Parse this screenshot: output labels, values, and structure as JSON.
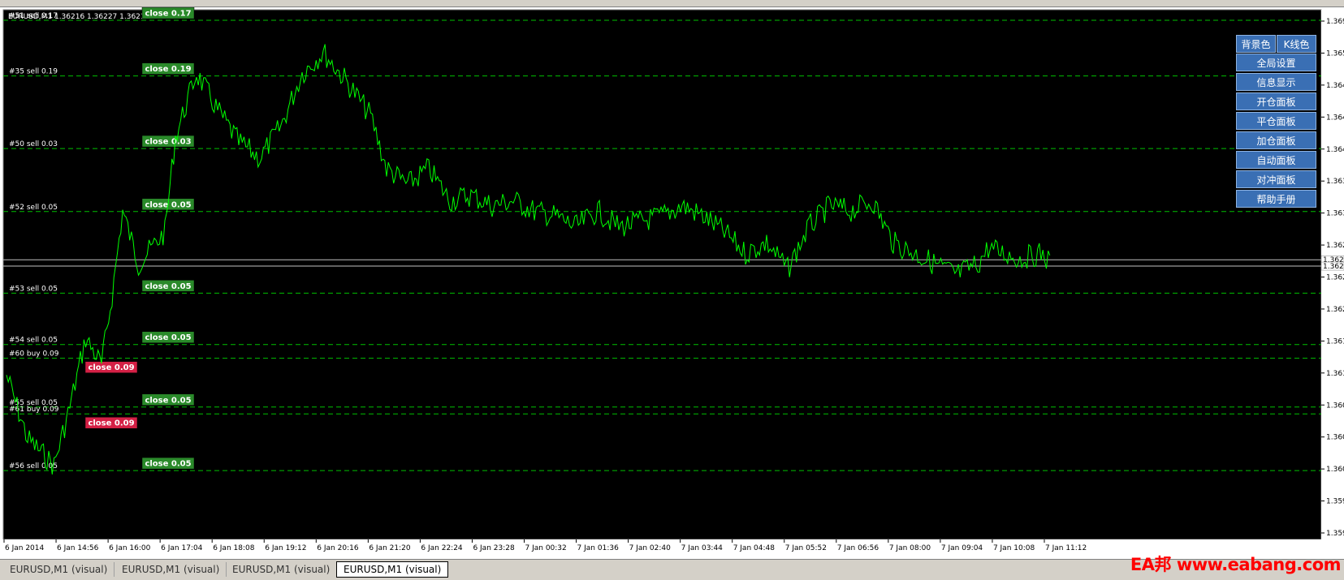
{
  "chart": {
    "symbol_info": "EURUSD,M1  1.36216 1.36227 1.36214 1.36225",
    "line_color": "#00ff00",
    "background": "#000000",
    "grid_line_color": "#00c000",
    "y_axis_labels": [
      "1.369",
      "1.365",
      "1.364",
      "1.364",
      "1.364",
      "1.363",
      "1.363",
      "1.362",
      "1.362",
      "1.362",
      "1.361",
      "1.361",
      "1.360",
      "1.360",
      "1.360",
      "1.359",
      "1.359"
    ],
    "price_tags": [
      "1.362",
      "1.362"
    ],
    "x_axis_labels": [
      "6 Jan 2014",
      "6 Jan 14:56",
      "6 Jan 16:00",
      "6 Jan 17:04",
      "6 Jan 18:08",
      "6 Jan 19:12",
      "6 Jan 20:16",
      "6 Jan 21:20",
      "6 Jan 22:24",
      "6 Jan 23:28",
      "7 Jan 00:32",
      "7 Jan 01:36",
      "7 Jan 02:40",
      "7 Jan 03:44",
      "7 Jan 04:48",
      "7 Jan 05:52",
      "7 Jan 06:56",
      "7 Jan 08:00",
      "7 Jan 09:04",
      "7 Jan 10:08",
      "7 Jan 11:12"
    ]
  },
  "orders": [
    {
      "label": "#51 sell 0.17",
      "close": "close 0.17",
      "type": "sell",
      "level": 0.02
    },
    {
      "label": "#35 sell 0.19",
      "close": "close 0.19",
      "type": "sell",
      "level": 0.125
    },
    {
      "label": "#50 sell 0.03",
      "close": "close 0.03",
      "type": "sell",
      "level": 0.262
    },
    {
      "label": "#52 sell 0.05",
      "close": "close 0.05",
      "type": "sell",
      "level": 0.381
    },
    {
      "label": "#53 sell 0.05",
      "close": "close 0.05",
      "type": "sell",
      "level": 0.535
    },
    {
      "label": "#54 sell 0.05",
      "close": "close 0.05",
      "type": "sell",
      "level": 0.632
    },
    {
      "label": "#60 buy 0.09",
      "close": "close 0.09",
      "type": "buy",
      "level": 0.658
    },
    {
      "label": "#55 sell 0.05",
      "close": "close 0.05",
      "type": "sell",
      "level": 0.75
    },
    {
      "label": "#61 buy 0.09",
      "close": "close 0.09",
      "type": "buy",
      "level": 0.763
    },
    {
      "label": "#56 sell 0.05",
      "close": "close 0.05",
      "type": "sell",
      "level": 0.87
    }
  ],
  "panel": {
    "bg_color_button": "背景色",
    "kline_color_button": "K线色",
    "items": [
      "全局设置",
      "信息显示",
      "开仓面板",
      "平仓面板",
      "加仓面板",
      "自动面板",
      "对冲面板",
      "帮助手册"
    ]
  },
  "tabs": [
    "EURUSD,M1 (visual)",
    "EURUSD,M1 (visual)",
    "EURUSD,M1 (visual)",
    "EURUSD,M1 (visual)"
  ],
  "watermark": "EA邦 www.eabang.com"
}
